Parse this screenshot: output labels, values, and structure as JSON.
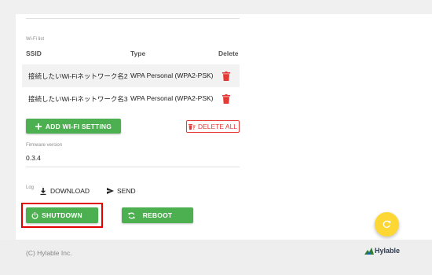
{
  "wifi": {
    "section_label": "Wi-Fi list",
    "columns": {
      "ssid": "SSID",
      "type": "Type",
      "delete": "Delete"
    },
    "rows": [
      {
        "ssid": "接続したいWi-Fiネットワーク名2",
        "type": "WPA Personal (WPA2-PSK)"
      },
      {
        "ssid": "接続したいWi-Fiネットワーク名3",
        "type": "WPA Personal (WPA2-PSK)"
      }
    ],
    "add_label": "ADD WI-FI SETTING",
    "delete_all_label": "DELETE ALL"
  },
  "firmware": {
    "label": "Firmware version",
    "value": "0.3.4"
  },
  "log": {
    "label": "Log",
    "download_label": "DOWNLOAD",
    "send_label": "SEND"
  },
  "power": {
    "shutdown_label": "SHUTDOWN",
    "reboot_label": "REBOOT"
  },
  "footer": {
    "copyright": "(C) Hylable Inc.",
    "logo_text": "Hylable"
  },
  "colors": {
    "primary_green": "#4caf50",
    "danger_red": "#e53935",
    "fab_yellow": "#fdd835",
    "highlight_red": "#e00000"
  },
  "icons": {
    "row_delete": "trash-icon",
    "add": "plus-icon",
    "delete_all": "delete-sweep-icon",
    "download": "download-icon",
    "send": "send-icon",
    "shutdown": "power-icon",
    "reboot": "refresh-icon",
    "fab": "refresh-icon"
  }
}
